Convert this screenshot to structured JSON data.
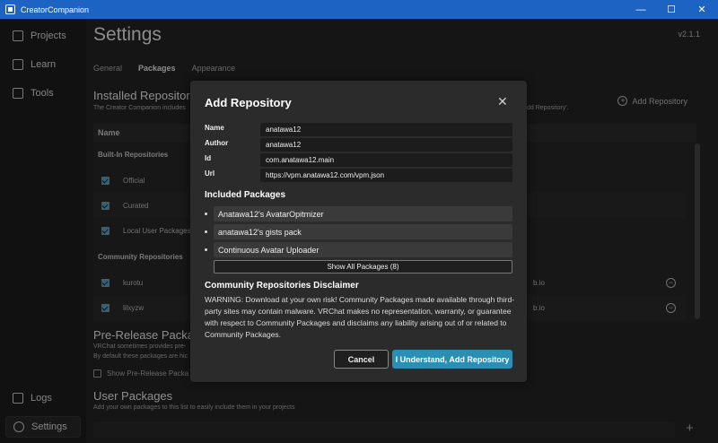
{
  "window": {
    "title": "CreatorCompanion",
    "minimize": "—",
    "maximize": "☐",
    "close": "✕"
  },
  "sidebar": {
    "items": [
      {
        "label": "Projects",
        "icon": "grid-icon"
      },
      {
        "label": "Learn",
        "icon": "question-icon"
      },
      {
        "label": "Tools",
        "icon": "toolbox-icon"
      }
    ],
    "bottom": [
      {
        "label": "Logs",
        "icon": "document-icon"
      },
      {
        "label": "Settings",
        "icon": "gear-icon",
        "active": true
      }
    ]
  },
  "header": {
    "title": "Settings",
    "version": "v2.1.1"
  },
  "tabs": [
    {
      "label": "General"
    },
    {
      "label": "Packages",
      "active": true
    },
    {
      "label": "Appearance"
    }
  ],
  "installed": {
    "title": "Installed Repositori",
    "desc": "The Creator Companion includes",
    "desc_tail": "dd Repository'.",
    "add_label": "Add Repository",
    "column_name": "Name",
    "builtin_group": "Built-In Repositories",
    "builtin": [
      {
        "label": "Official"
      },
      {
        "label": "Curated"
      },
      {
        "label": "Local User Packages"
      }
    ],
    "community_group": "Community Repositories",
    "community": [
      {
        "label": "kurotu",
        "url_tail": "b.io"
      },
      {
        "label": "lilxyzw",
        "url_tail": "b.io"
      }
    ]
  },
  "prerelease": {
    "title": "Pre-Release Packag",
    "desc1": "VRChat sometimes provides pre-",
    "desc2": "By default these packages are hic",
    "checkbox_label": "Show Pre-Release Packa"
  },
  "user_packages": {
    "title": "User Packages",
    "desc": "Add your own packages to this list to easily include them in your projects",
    "add": "+"
  },
  "modal": {
    "title": "Add Repository",
    "close": "✕",
    "fields": [
      {
        "label": "Name",
        "value": "anatawa12"
      },
      {
        "label": "Author",
        "value": "anatawa12"
      },
      {
        "label": "Id",
        "value": "com.anatawa12.main"
      },
      {
        "label": "Url",
        "value": "https://vpm.anatawa12.com/vpm.json"
      }
    ],
    "included_title": "Included Packages",
    "packages": [
      "Anatawa12's AvatarOpitmizer",
      "anatawa12's gists pack",
      "Continuous Avatar Uploader"
    ],
    "show_all": "Show All Packages (8)",
    "disclaimer_title": "Community Repositories Disclaimer",
    "disclaimer_text": "WARNING: Download at your own risk! Community Packages made available through third-party sites may contain malware. VRChat makes no representation, warranty, or guarantee with respect to Community Packages and disclaims any liability arising out of or related to Community Packages.",
    "cancel": "Cancel",
    "accept": "I Understand, Add Repository"
  }
}
